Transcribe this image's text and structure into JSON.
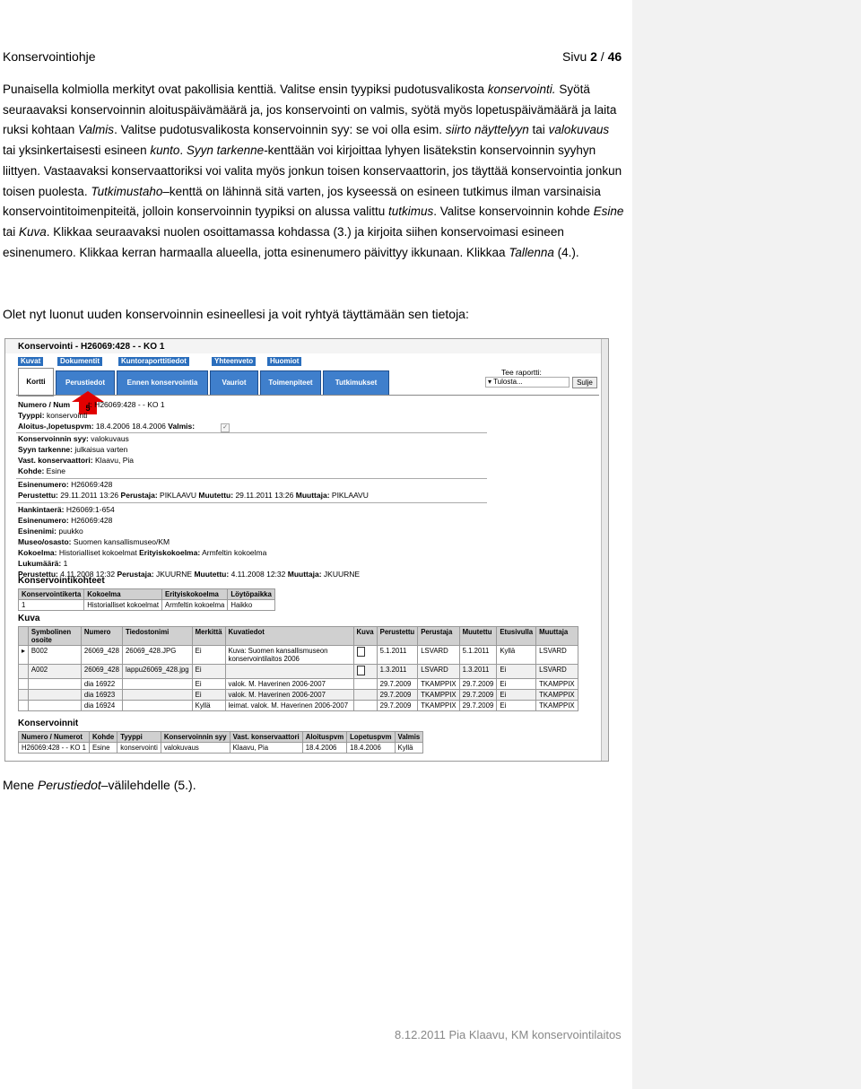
{
  "header": {
    "left": "Konservointiohje",
    "page_prefix": "Sivu ",
    "page_current": "2",
    "page_sep": " / ",
    "page_total": "46"
  },
  "paragraph": {
    "s1": "Punaisella kolmiolla merkityt ovat pakollisia kenttiä. Valitse ensin tyypiksi pudotusvalikosta ",
    "s1_i": "konservointi.",
    "s2": " Syötä seuraavaksi konservoinnin aloituspäivämäärä ja, jos konservointi on valmis, syötä myös lopetuspäivämäärä ja laita ruksi kohtaan ",
    "s2_i": "Valmis",
    "s3": ". Valitse pudotusvalikosta konservoinnin syy: se voi olla esim. ",
    "s3_i1": "siirto näyttelyyn",
    "s3_a": " tai ",
    "s3_i2": "valokuvaus",
    "s3_b": " tai yksinkertaisesti esineen ",
    "s3_i3": "kunto",
    "s3_c": ". ",
    "s4_i": "Syyn tarkenne",
    "s4": "-kenttään voi kirjoittaa lyhyen lisätekstin konservoinnin syyhyn liittyen. Vastaavaksi konservaattoriksi voi valita myös jonkun toisen konservaattorin, jos täyttää konservointia jonkun toisen puolesta. ",
    "s5_i": "Tutkimustaho",
    "s5": "–kenttä on lähinnä sitä varten, jos kyseessä on esineen tutkimus ilman varsinaisia konservointitoimenpiteitä, jolloin konservoinnin tyypiksi on alussa valittu ",
    "s5_i2": "tutkimus",
    "s6": ". Valitse konservoinnin kohde ",
    "s6_i1": "Esine",
    "s6_a": " tai ",
    "s6_i2": "Kuva",
    "s6_b": ". Klikkaa seuraavaksi nuolen osoittamassa kohdassa (3.) ja kirjoita siihen konservoimasi esineen esinenumero. Klikkaa kerran harmaalla alueella, jotta esinenumero päivittyy ikkunaan. Klikkaa ",
    "s7_i": "Tallenna",
    "s7": " (4.)."
  },
  "intro": "Olet nyt luonut uuden konservoinnin esineellesi ja voit ryhtyä täyttämään sen tietoja:",
  "screenshot": {
    "title": "Konservointi  - H26069:428 - - KO 1",
    "nav": [
      "Kuvat",
      "Dokumentit",
      "Kuntoraporttitiedot",
      "Yhteenveto",
      "Huomiot"
    ],
    "tabs": [
      "Kortti",
      "Perustiedot",
      "Ennen konservointia",
      "Vauriot",
      "Toimenpiteet",
      "Tutkimukset"
    ],
    "report_label": "Tee raportti:",
    "report_select": "Tulosta...",
    "close": "Sulje",
    "arrow_label": "5",
    "fields": {
      "numero_l": "Numero / Num",
      "numero_v": "t: H26069:428 - - KO 1",
      "tyyppi_l": "Tyyppi:",
      "tyyppi_v": "konservointi",
      "aloitus_l": "Aloitus-,lopetuspvm:",
      "aloitus_v": "18.4.2006   18.4.2006",
      "valmis_l": "Valmis:",
      "syy_l": "Konservoinnin syy:",
      "syy_v": "valokuvaus",
      "tarkenne_l": "Syyn tarkenne:",
      "tarkenne_v": "julkaisua varten",
      "vast_l": "Vast. konservaattori:",
      "vast_v": "Klaavu, Pia",
      "kohde_l": "Kohde:",
      "kohde_v": "Esine",
      "esinenumero_l": "Esinenumero:",
      "esinenumero_v": "H26069:428",
      "perustettu1_l": "Perustettu:",
      "perustettu1_v": "29.11.2011 13:26",
      "perustaja1_l": "Perustaja:",
      "perustaja1_v": "PIKLAAVU",
      "muutettu1_l": "Muutettu:",
      "muutettu1_v": "29.11.2011 13:26",
      "muuttaja1_l": "Muuttaja:",
      "muuttaja1_v": "PIKLAAVU",
      "hankinta_l": "Hankintaerä:",
      "hankinta_v": "H26069:1-654",
      "esinenumero2_l": "Esinenumero:",
      "esinenumero2_v": "H26069:428",
      "esinenimi_l": "Esinenimi:",
      "esinenimi_v": "puukko",
      "museo_l": "Museo/osasto:",
      "museo_v": "Suomen kansallismuseo/KM",
      "kokoelma_l": "Kokoelma:",
      "kokoelma_v": "Historialliset kokoelmat",
      "erityis_l": "Erityiskokoelma:",
      "erityis_v": "Armfeltin kokoelma",
      "lukumaara_l": "Lukumäärä:",
      "lukumaara_v": "1",
      "perustettu2_l": "Perustettu:",
      "perustettu2_v": "4.11.2008 12:32",
      "perustaja2_l": "Perustaja:",
      "perustaja2_v": "JKUURNE",
      "muutettu2_l": "Muutettu:",
      "muutettu2_v": "4.11.2008 12:32",
      "muuttaja2_l": "Muuttaja:",
      "muuttaja2_v": "JKUURNE"
    },
    "kohteet_title": "Konservointikohteet",
    "kohteet_headers": [
      "Konservointikerta",
      "Kokoelma",
      "Erityiskokoelma",
      "Löytöpaikka"
    ],
    "kohteet_rows": [
      [
        "1",
        "Historialliset kokoelmat",
        "Armfeltin kokoelma",
        "Haikko"
      ]
    ],
    "kuva_title": "Kuva",
    "kuva_headers": [
      "Symbolinen osoite",
      "Numero",
      "Tiedostonimi",
      "Merkittä",
      "Kuvatiedot",
      "Kuva",
      "Perustettu",
      "Perustaja",
      "Muutettu",
      "Etusivulla",
      "Muuttaja"
    ],
    "kuva_rows": [
      [
        "B002",
        "26069_428",
        "26069_428.JPG",
        "Ei",
        "Kuva: Suomen kansallismuseon konservointilaitos 2006",
        "1",
        "5.1.2011",
        "LSVARD",
        "5.1.2011",
        "Kyllä",
        "LSVARD"
      ],
      [
        "A002",
        "26069_428",
        "lappu26069_428.jpg",
        "Ei",
        "",
        "1",
        "1.3.2011",
        "LSVARD",
        "1.3.2011",
        "Ei",
        "LSVARD"
      ],
      [
        "",
        "dia 16922",
        "",
        "Ei",
        "valok. M. Haverinen 2006-2007",
        "",
        "29.7.2009",
        "TKAMPPIX",
        "29.7.2009",
        "Ei",
        "TKAMPPIX"
      ],
      [
        "",
        "dia 16923",
        "",
        "Ei",
        "valok. M. Haverinen 2006-2007",
        "",
        "29.7.2009",
        "TKAMPPIX",
        "29.7.2009",
        "Ei",
        "TKAMPPIX"
      ],
      [
        "",
        "dia 16924",
        "",
        "Kyllä",
        "leimat. valok. M. Haverinen 2006-2007",
        "",
        "29.7.2009",
        "TKAMPPIX",
        "29.7.2009",
        "Ei",
        "TKAMPPIX"
      ]
    ],
    "kons_title": "Konservoinnit",
    "kons_headers": [
      "Numero / Numerot",
      "Kohde",
      "Tyyppi",
      "Konservoinnin syy",
      "Vast. konservaattori",
      "Aloituspvm",
      "Lopetuspvm",
      "Valmis"
    ],
    "kons_rows": [
      [
        "H26069:428 - - KO 1",
        "Esine",
        "konservointi",
        "valokuvaus",
        "Klaavu, Pia",
        "18.4.2006",
        "18.4.2006",
        "Kyllä"
      ]
    ]
  },
  "menne": {
    "a": "Mene ",
    "i": "Perustiedot",
    "b": "–välilehdelle (5.)."
  },
  "footer": "8.12.2011 Pia Klaavu, KM konservointilaitos"
}
